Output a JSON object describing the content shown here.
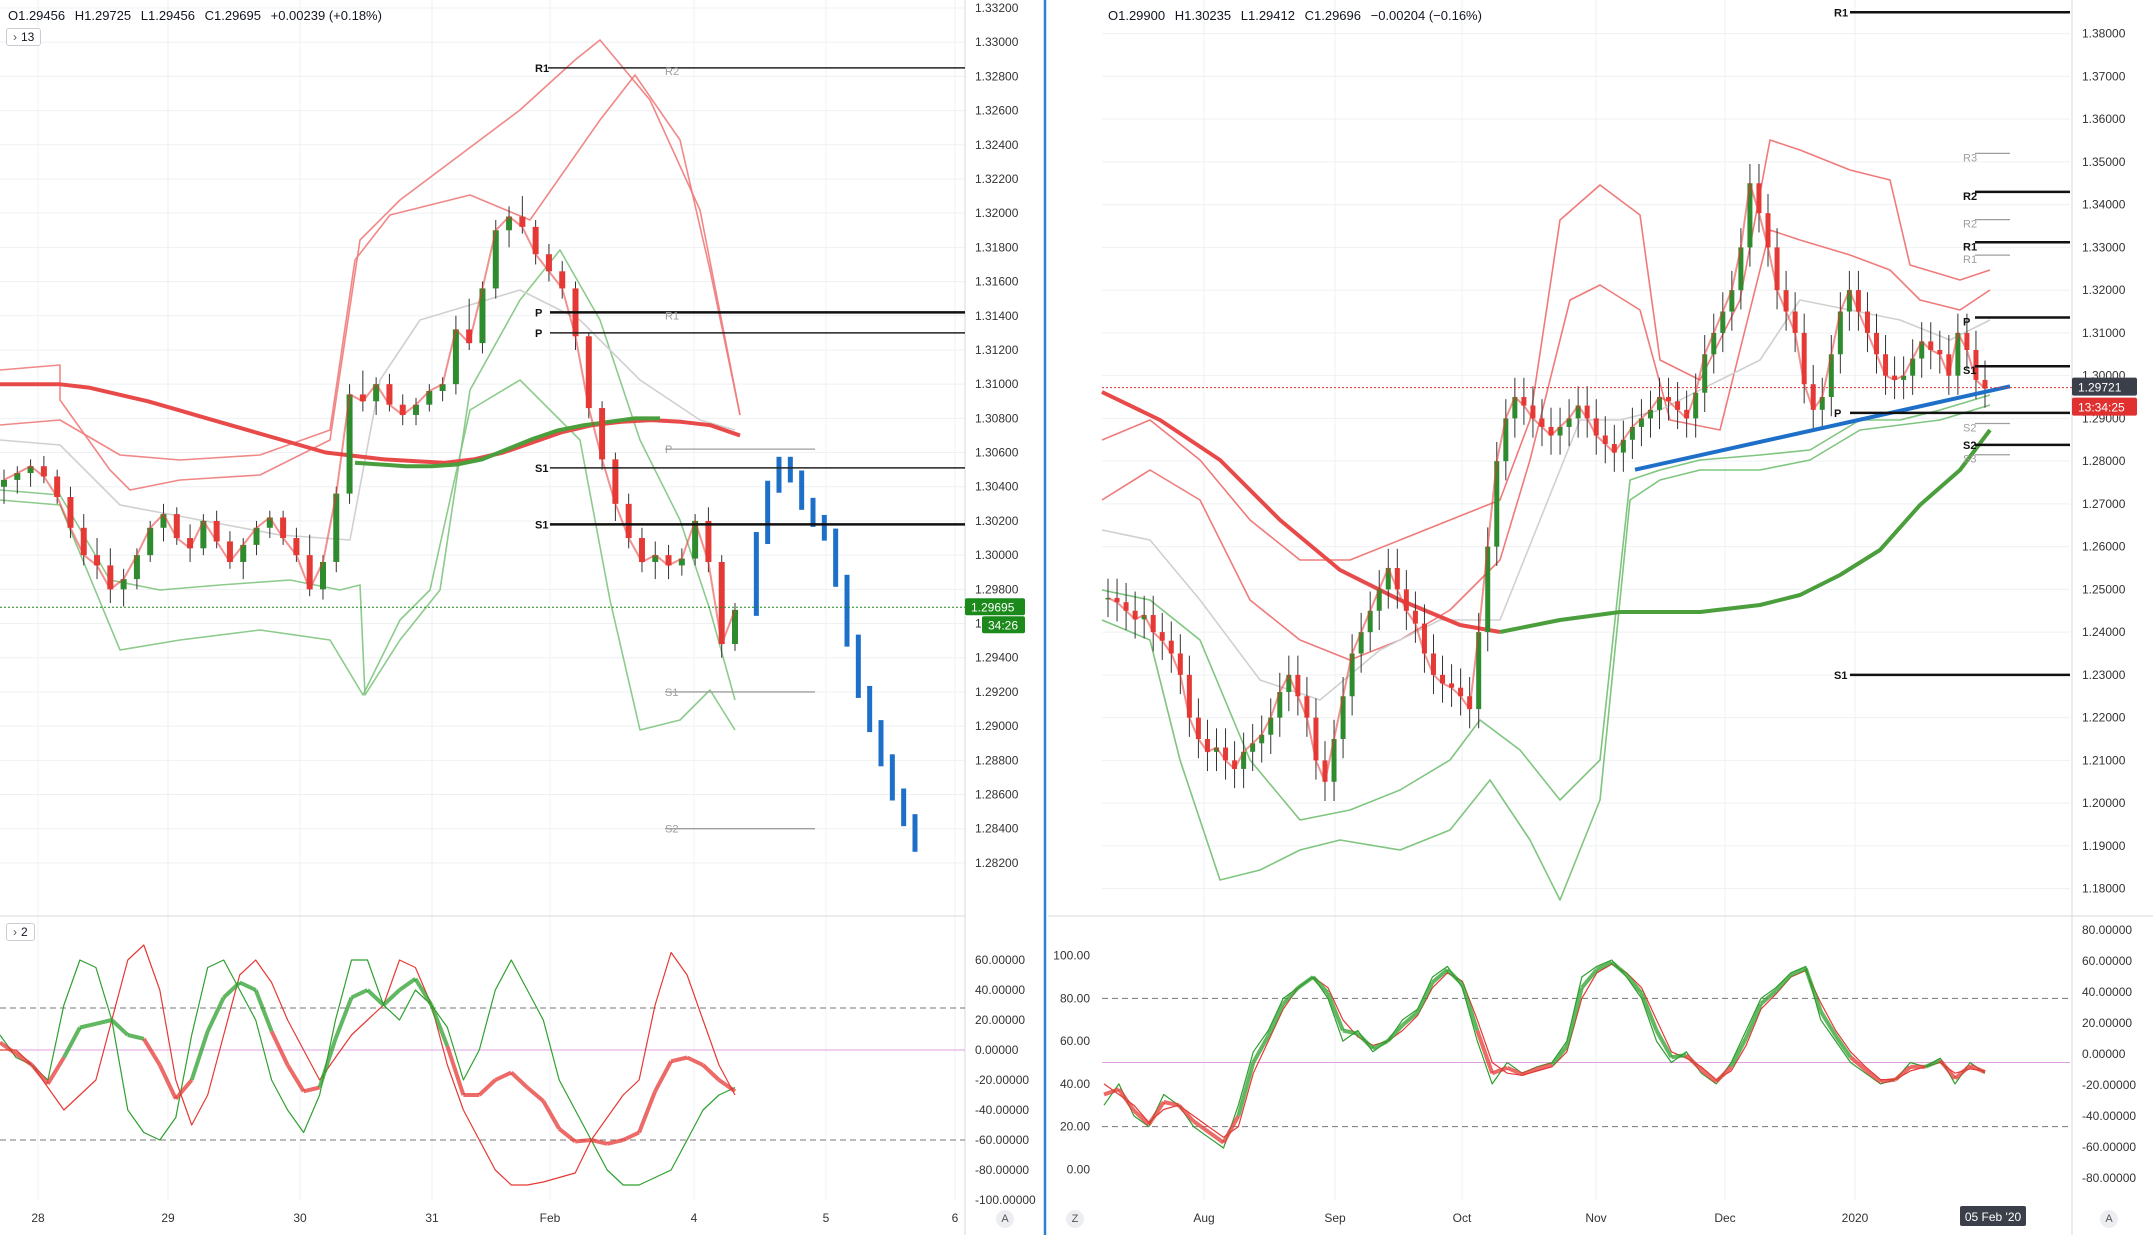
{
  "colors": {
    "up": "#2e8b2e",
    "down": "#e53935",
    "blue": "#1e6fc8",
    "bb_red": "#f07a7a",
    "bb_green": "#7fc57f",
    "ma_red": "#e84a4a",
    "ma_green": "#4a9e3c",
    "pivot_gray": "#9e9e9e",
    "divider": "#2f80d1",
    "grid": "#eef0f3",
    "last_green": "#1b8a1b",
    "last_red": "#e03030",
    "dark_label": "#3a3f4a",
    "stoch_fast": "#2ea02e",
    "stoch_slow": "#e53935",
    "band_pink": "#e0a0e0"
  },
  "left_panel": {
    "ohlc": {
      "o": "O1.29456",
      "h": "H1.29725",
      "l": "L1.29456",
      "c": "C1.29695",
      "chg": "+0.00239 (+0.18%)"
    },
    "indicator_toggle": "13",
    "last_price": "1.29695",
    "countdown": "34:26",
    "price_axis": [
      "1.33200",
      "1.33000",
      "1.32800",
      "1.32600",
      "1.32400",
      "1.32200",
      "1.32000",
      "1.31800",
      "1.31600",
      "1.31400",
      "1.31200",
      "1.31000",
      "1.30800",
      "1.30600",
      "1.30400",
      "1.30200",
      "1.30000",
      "1.29800",
      "1.29600",
      "1.29400",
      "1.29200",
      "1.29000",
      "1.28800",
      "1.28600",
      "1.28400",
      "1.28200"
    ],
    "pivot_labels": [
      "R1",
      "R2",
      "P",
      "P",
      "R1",
      "S1",
      "S1",
      "P",
      "S1",
      "S2"
    ],
    "time_axis": [
      "28",
      "29",
      "30",
      "31",
      "Feb",
      "4",
      "5",
      "6"
    ],
    "osc_toggle": "2",
    "osc_axis": [
      "60.00000",
      "40.00000",
      "20.00000",
      "0.00000",
      "-20.00000",
      "-40.00000",
      "-60.00000",
      "-80.00000",
      "-100.00000"
    ],
    "scale_mode": "A"
  },
  "right_panel": {
    "ohlc": {
      "o": "O1.29900",
      "h": "H1.30235",
      "l": "L1.29412",
      "c": "C1.29696",
      "chg": "−0.00204 (−0.16%)"
    },
    "last_price": "1.29721",
    "countdown": "13:34:25",
    "price_axis": [
      "1.38000",
      "1.37000",
      "1.36000",
      "1.35000",
      "1.34000",
      "1.33000",
      "1.32000",
      "1.31000",
      "1.30000",
      "1.29000",
      "1.28000",
      "1.27000",
      "1.26000",
      "1.25000",
      "1.24000",
      "1.23000",
      "1.22000",
      "1.21000",
      "1.20000",
      "1.19000",
      "1.18000"
    ],
    "pivot_labels": [
      "R1",
      "R3",
      "R2",
      "R2",
      "R1",
      "R1",
      "P",
      "S1",
      "P",
      "S2",
      "S2",
      "S3",
      "S1"
    ],
    "time_axis": [
      "Aug",
      "Sep",
      "Oct",
      "Nov",
      "Dec",
      "2020"
    ],
    "date_badge": "05 Feb '20",
    "osc_left_axis": [
      "100.00",
      "80.00",
      "60.00",
      "40.00",
      "20.00",
      "0.00"
    ],
    "osc_right_axis": [
      "80.00000",
      "60.00000",
      "40.00000",
      "20.00000",
      "0.00000",
      "-20.00000",
      "-40.00000",
      "-60.00000",
      "-80.00000"
    ],
    "zoom_btn": "Z",
    "scale_mode": "A"
  },
  "chart_data": [
    {
      "type": "candlestick",
      "title": "",
      "timeframe_note": "intraday",
      "xlabel": "",
      "ylabel": "",
      "ylim": [
        1.281,
        1.332
      ],
      "x_ticks": [
        "28",
        "29",
        "30",
        "31",
        "Feb",
        "4",
        "5",
        "6"
      ],
      "last_close": 1.29695,
      "candles_ohlc": [
        [
          1.304,
          1.305,
          1.303,
          1.3044
        ],
        [
          1.3044,
          1.3052,
          1.3036,
          1.3048
        ],
        [
          1.3048,
          1.3056,
          1.304,
          1.3052
        ],
        [
          1.3052,
          1.3058,
          1.3042,
          1.3046
        ],
        [
          1.3046,
          1.305,
          1.303,
          1.3034
        ],
        [
          1.3034,
          1.304,
          1.301,
          1.3016
        ],
        [
          1.3016,
          1.3024,
          1.2994,
          1.3
        ],
        [
          1.3,
          1.301,
          1.2986,
          1.2994
        ],
        [
          1.2994,
          1.3004,
          1.2972,
          1.298
        ],
        [
          1.298,
          1.2992,
          1.297,
          1.2986
        ],
        [
          1.2986,
          1.3004,
          1.298,
          1.3
        ],
        [
          1.3,
          1.302,
          1.2996,
          1.3016
        ],
        [
          1.3016,
          1.303,
          1.3008,
          1.3024
        ],
        [
          1.3024,
          1.3028,
          1.3006,
          1.301
        ],
        [
          1.301,
          1.3018,
          1.2996,
          1.3004
        ],
        [
          1.3004,
          1.3024,
          1.3,
          1.302
        ],
        [
          1.302,
          1.3026,
          1.3004,
          1.3008
        ],
        [
          1.3008,
          1.3014,
          1.2992,
          1.2996
        ],
        [
          1.2996,
          1.301,
          1.2986,
          1.3006
        ],
        [
          1.3006,
          1.302,
          1.3,
          1.3016
        ],
        [
          1.3016,
          1.3026,
          1.301,
          1.3022
        ],
        [
          1.3022,
          1.3026,
          1.3006,
          1.301
        ],
        [
          1.301,
          1.3016,
          1.2996,
          1.3
        ],
        [
          1.3,
          1.3012,
          1.2976,
          1.298
        ],
        [
          1.298,
          1.3,
          1.2974,
          1.2996
        ],
        [
          1.2996,
          1.304,
          1.299,
          1.3036
        ],
        [
          1.3036,
          1.31,
          1.303,
          1.3094
        ],
        [
          1.3094,
          1.3108,
          1.3084,
          1.309
        ],
        [
          1.309,
          1.3104,
          1.3082,
          1.31
        ],
        [
          1.31,
          1.3106,
          1.3084,
          1.3088
        ],
        [
          1.3088,
          1.3094,
          1.3076,
          1.3082
        ],
        [
          1.3082,
          1.3092,
          1.3076,
          1.3088
        ],
        [
          1.3088,
          1.31,
          1.3084,
          1.3096
        ],
        [
          1.3096,
          1.3104,
          1.309,
          1.31
        ],
        [
          1.31,
          1.314,
          1.3094,
          1.3132
        ],
        [
          1.3132,
          1.315,
          1.312,
          1.3124
        ],
        [
          1.3124,
          1.316,
          1.3118,
          1.3156
        ],
        [
          1.3156,
          1.3196,
          1.315,
          1.319
        ],
        [
          1.319,
          1.3204,
          1.318,
          1.3198
        ],
        [
          1.3198,
          1.321,
          1.3188,
          1.3192
        ],
        [
          1.3192,
          1.3196,
          1.317,
          1.3176
        ],
        [
          1.3176,
          1.3182,
          1.316,
          1.3166
        ],
        [
          1.3166,
          1.3172,
          1.315,
          1.3156
        ],
        [
          1.3156,
          1.316,
          1.312,
          1.3128
        ],
        [
          1.3128,
          1.313,
          1.308,
          1.3086
        ],
        [
          1.3086,
          1.309,
          1.305,
          1.3056
        ],
        [
          1.3056,
          1.306,
          1.302,
          1.303
        ],
        [
          1.303,
          1.3036,
          1.3004,
          1.301
        ],
        [
          1.301,
          1.3016,
          1.299,
          1.2996
        ],
        [
          1.2996,
          1.3008,
          1.2986,
          1.3
        ],
        [
          1.3,
          1.3006,
          1.2986,
          1.2994
        ],
        [
          1.2994,
          1.3004,
          1.2988,
          1.2998
        ],
        [
          1.2998,
          1.3024,
          1.2994,
          1.302
        ],
        [
          1.302,
          1.3028,
          1.299,
          1.2996
        ],
        [
          1.2996,
          1.3,
          1.294,
          1.2948
        ],
        [
          1.2948,
          1.2972,
          1.2944,
          1.2968
        ]
      ],
      "projection_blue_path": [
        1.2968,
        1.301,
        1.304,
        1.3054,
        1.3046,
        1.303,
        1.302,
        1.3012,
        1.2985,
        1.295,
        1.292,
        1.29,
        1.288,
        1.286,
        1.2845,
        1.283
      ],
      "horizontal_levels": {
        "R1": 1.3285,
        "P_thick": 1.3142,
        "P_thin": 1.313,
        "S1_thin": 1.3051,
        "S1_thick": 1.3018,
        "P_gray": 1.3062,
        "S1_gray": 1.292,
        "S2_gray": 1.284
      },
      "ma_red": [
        1.31,
        1.31,
        1.31,
        1.3098,
        1.3094,
        1.309,
        1.3085,
        1.308,
        1.3075,
        1.307,
        1.3065,
        1.306,
        1.3058,
        1.3056,
        1.3055,
        1.3054,
        1.3056,
        1.306,
        1.3066,
        1.3072,
        1.3076,
        1.3078,
        1.3079,
        1.3078,
        1.3076,
        1.307
      ],
      "ma_green": [
        1.3054,
        1.3053,
        1.3052,
        1.3052,
        1.3053,
        1.3056,
        1.3062,
        1.3068,
        1.3073,
        1.3076,
        1.3078,
        1.308,
        1.308
      ],
      "stochastic": {
        "ylim": [
          -100,
          70
        ],
        "levels": [
          28,
          0,
          -60
        ],
        "fast_k": [
          10,
          -5,
          -10,
          -20,
          30,
          60,
          55,
          20,
          -40,
          -55,
          -60,
          -45,
          10,
          55,
          60,
          40,
          20,
          -20,
          -40,
          -55,
          -30,
          20,
          60,
          60,
          30,
          20,
          40,
          30,
          15,
          -20,
          0,
          40,
          60,
          40,
          20,
          -20,
          -40,
          -60,
          -80,
          -90,
          -90,
          -85,
          -80,
          -60,
          -40,
          -30,
          -25
        ],
        "slow_d": [
          0,
          0,
          -10,
          -25,
          -40,
          -30,
          -20,
          20,
          60,
          70,
          40,
          -20,
          -50,
          -30,
          10,
          50,
          60,
          45,
          20,
          0,
          -20,
          -5,
          10,
          20,
          30,
          60,
          55,
          30,
          -10,
          -40,
          -60,
          -80,
          -90,
          -90,
          -88,
          -85,
          -82,
          -60,
          -45,
          -30,
          -20,
          30,
          65,
          50,
          20,
          -10,
          -30
        ]
      }
    },
    {
      "type": "candlestick",
      "title": "",
      "timeframe_note": "daily",
      "xlabel": "",
      "ylabel": "",
      "ylim": [
        1.175,
        1.386
      ],
      "x_ticks": [
        "Aug",
        "Sep",
        "Oct",
        "Nov",
        "Dec",
        "2020"
      ],
      "last_close": 1.29721,
      "close_path": [
        1.248,
        1.247,
        1.245,
        1.243,
        1.244,
        1.24,
        1.238,
        1.235,
        1.23,
        1.22,
        1.215,
        1.212,
        1.213,
        1.21,
        1.208,
        1.212,
        1.214,
        1.216,
        1.22,
        1.226,
        1.23,
        1.225,
        1.22,
        1.21,
        1.205,
        1.215,
        1.225,
        1.235,
        1.24,
        1.245,
        1.25,
        1.255,
        1.25,
        1.245,
        1.242,
        1.235,
        1.23,
        1.228,
        1.227,
        1.225,
        1.222,
        1.24,
        1.26,
        1.28,
        1.29,
        1.295,
        1.293,
        1.29,
        1.288,
        1.286,
        1.288,
        1.29,
        1.293,
        1.29,
        1.286,
        1.284,
        1.282,
        1.285,
        1.288,
        1.29,
        1.292,
        1.295,
        1.294,
        1.292,
        1.29,
        1.296,
        1.305,
        1.31,
        1.315,
        1.32,
        1.33,
        1.345,
        1.338,
        1.33,
        1.32,
        1.315,
        1.31,
        1.298,
        1.292,
        1.295,
        1.305,
        1.315,
        1.32,
        1.315,
        1.31,
        1.305,
        1.3,
        1.299,
        1.3,
        1.304,
        1.308,
        1.306,
        1.305,
        1.3,
        1.31,
        1.306,
        1.299,
        1.297
      ],
      "trendline": [
        [
          1.278,
          1.2975
        ]
      ],
      "horizontal_levels": {
        "R1_top": 1.385,
        "R3": 1.352,
        "R2": 1.343,
        "R2_gray": 1.3365,
        "R1": 1.3312,
        "R1_gray": 1.3282,
        "P": 1.3136,
        "S1": 1.3022,
        "P_low": 1.2913,
        "S2_gray": 1.2888,
        "S2": 1.2838,
        "S3": 1.2815,
        "S1_low": 1.23
      },
      "stochastic": {
        "ylim": [
          -5,
          105
        ],
        "levels": [
          80,
          50,
          20
        ],
        "fast_k": [
          30,
          40,
          25,
          20,
          35,
          30,
          20,
          15,
          10,
          30,
          55,
          65,
          80,
          85,
          90,
          80,
          60,
          65,
          55,
          60,
          70,
          75,
          90,
          95,
          85,
          60,
          40,
          50,
          45,
          48,
          50,
          60,
          90,
          95,
          98,
          90,
          80,
          60,
          50,
          55,
          45,
          40,
          50,
          65,
          80,
          85,
          92,
          95,
          70,
          60,
          50,
          45,
          40,
          42,
          50,
          48,
          52,
          40,
          50,
          45
        ],
        "slow_d": [
          40,
          35,
          30,
          22,
          28,
          30,
          25,
          20,
          15,
          20,
          45,
          60,
          75,
          85,
          90,
          85,
          70,
          62,
          58,
          60,
          65,
          72,
          85,
          92,
          88,
          70,
          50,
          45,
          44,
          46,
          48,
          55,
          80,
          92,
          96,
          92,
          85,
          70,
          55,
          52,
          48,
          42,
          46,
          58,
          75,
          82,
          90,
          93,
          78,
          65,
          55,
          48,
          42,
          42,
          46,
          48,
          50,
          45,
          47,
          46
        ]
      }
    }
  ]
}
